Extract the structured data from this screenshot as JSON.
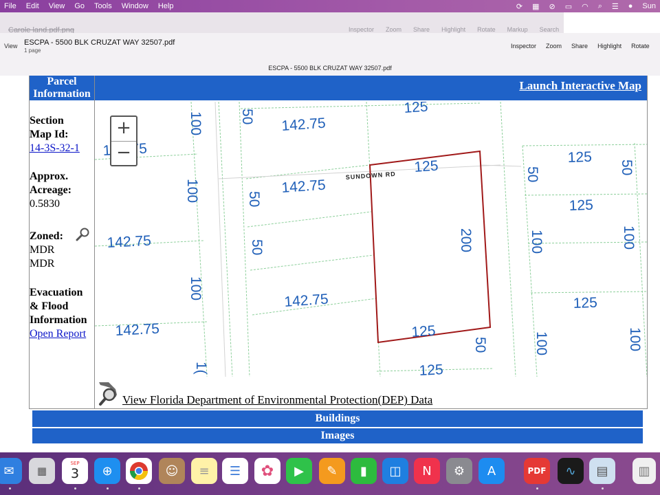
{
  "menubar": {
    "items": [
      "File",
      "Edit",
      "View",
      "Go",
      "Tools",
      "Window",
      "Help"
    ],
    "clock": "Sun"
  },
  "ghost_window": {
    "title": "Carole land.pdf.png",
    "tools": [
      "Inspector",
      "Zoom",
      "Share",
      "Highlight",
      "Rotate",
      "Markup",
      "Search"
    ]
  },
  "toolbar": {
    "view_label": "View",
    "title": "ESCPA - 5500 BLK CRUZAT WAY 32507.pdf",
    "pages": "1 page",
    "tools": [
      "Inspector",
      "Zoom",
      "Share",
      "Highlight",
      "Rotate"
    ],
    "document_title": "ESCPA - 5500 BLK CRUZAT WAY 32507.pdf"
  },
  "sidebar": {
    "header_line1": "Parcel",
    "header_line2": "Information",
    "section_label1": "Section",
    "section_label2": "Map Id:",
    "section_value": "14-3S-32-1",
    "acreage_label1": "Approx.",
    "acreage_label2": "Acreage:",
    "acreage_value": "0.5830",
    "zoned_label": "Zoned:",
    "zoned_value1": "MDR",
    "zoned_value2": "MDR",
    "evac_label1": "Evacuation",
    "evac_label2": "& Flood",
    "evac_label3": "Information",
    "evac_link": "Open Report"
  },
  "topbar": {
    "link": "Launch Interactive Map"
  },
  "map": {
    "street": "SUNDOWN RD",
    "parcel_color": "#a01818",
    "dimension_color": "#1f5fb8",
    "labels": {
      "l1": "100",
      "l2": "50",
      "l3": "142.75",
      "l4": "125",
      "l5": "142.75",
      "l6": "125",
      "l7": "50",
      "l8": "50",
      "l9": "100",
      "l10": "142.75",
      "l11": "50",
      "l12": "125",
      "l13": "200",
      "l14": "142.75",
      "l15": "50",
      "l16": "125",
      "l17": "100",
      "l18": "100",
      "l19": "100",
      "l20": "142.75",
      "l21": "142.75",
      "l22": "125",
      "l23": "125",
      "l24": "100",
      "l25": "100",
      "l26": "50",
      "l27": "125",
      "l28": "1("
    }
  },
  "dep": {
    "link": "View Florida Department of Environmental Protection(DEP) Data"
  },
  "sections": {
    "buildings": "Buildings",
    "images": "Images"
  },
  "dock": {
    "calendar_month": "SEP",
    "calendar_day": "3",
    "apps": [
      "mail",
      "launchpad",
      "calendar",
      "safari",
      "chrome",
      "contacts",
      "notes",
      "reminders",
      "photos",
      "facetime",
      "pages",
      "numbers",
      "keynote",
      "news",
      "system-preferences",
      "app-store",
      "pdf-expert",
      "stocks",
      "preview",
      "documents"
    ]
  }
}
